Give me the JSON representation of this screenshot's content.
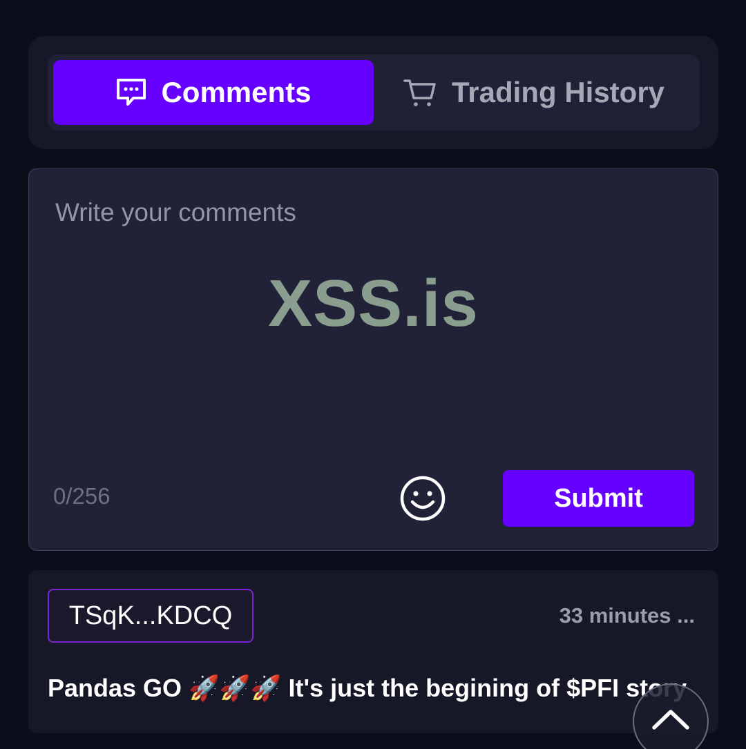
{
  "tabs": [
    {
      "label": "Comments",
      "icon": "comment-dots-icon",
      "active": true
    },
    {
      "label": "Trading History",
      "icon": "cart-icon",
      "active": false
    }
  ],
  "composer": {
    "placeholder": "Write your comments",
    "watermark": "XSS.is",
    "char_count": "0/256",
    "emoji_icon": "smiley-icon",
    "submit_label": "Submit"
  },
  "comments": [
    {
      "user": "TSqK...KDCQ",
      "time": "33 minutes ...",
      "text": "Pandas GO 🚀🚀🚀 It's just the begining of $PFI story"
    }
  ],
  "scroll_top_icon": "chevron-up-icon",
  "colors": {
    "accent": "#6600ff",
    "background": "#0b0d1b",
    "card": "#161727",
    "chip_border": "#7a24d6"
  }
}
